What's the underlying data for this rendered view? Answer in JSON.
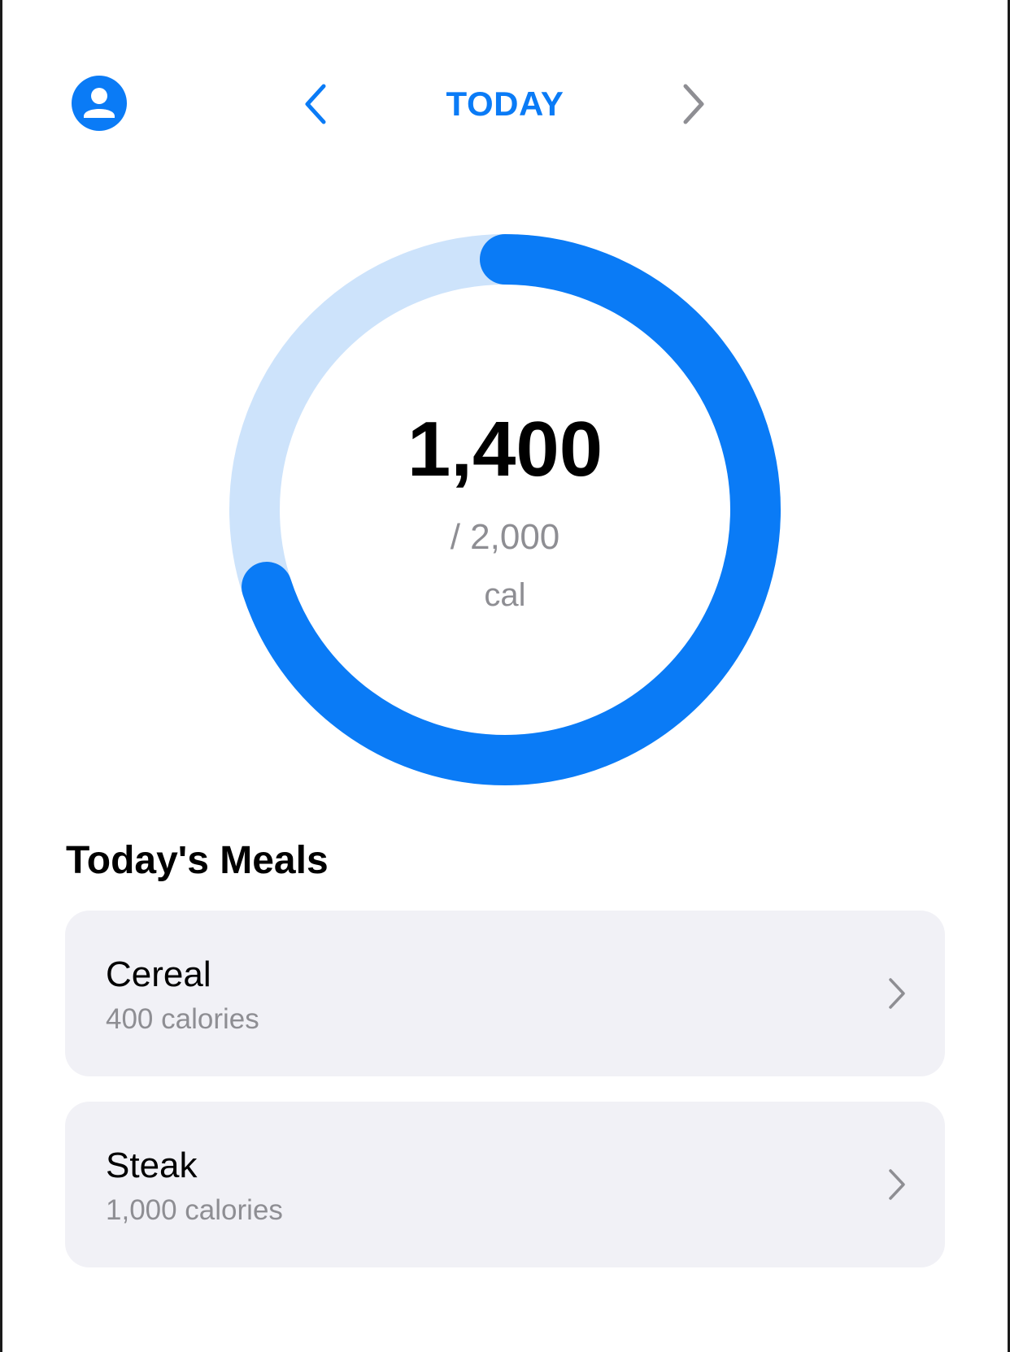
{
  "header": {
    "profile_icon": "person-circle-icon",
    "prev_icon": "chevron-left-icon",
    "next_icon": "chevron-right-icon",
    "date_label": "TODAY"
  },
  "summary": {
    "consumed": "1,400",
    "goal": "/ 2,000",
    "unit": "cal",
    "progress_fraction": 0.7
  },
  "meals": {
    "section_title": "Today's Meals",
    "items": [
      {
        "name": "Cereal",
        "calories": "400 calories"
      },
      {
        "name": "Steak",
        "calories": "1,000 calories"
      }
    ]
  },
  "colors": {
    "accent": "#0a7bf6",
    "ring_track": "#cde3fb",
    "card_bg": "#f1f1f6",
    "secondary_text": "#8e8e93"
  }
}
